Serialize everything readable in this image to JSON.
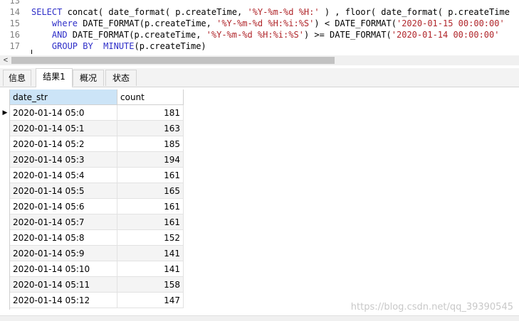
{
  "editor": {
    "lines": [
      {
        "num": "13",
        "parts": []
      },
      {
        "num": "14",
        "parts": [
          {
            "t": "SELECT",
            "c": "kw"
          },
          {
            "t": " concat( date_format( p.createTime, ",
            "c": "plain"
          },
          {
            "t": "'%Y-%m-%d %H:'",
            "c": "str"
          },
          {
            "t": " ) , floor( date_format( p.createTime",
            "c": "plain"
          }
        ]
      },
      {
        "num": "15",
        "parts": [
          {
            "t": "    where",
            "c": "kw"
          },
          {
            "t": " DATE_FORMAT(p.createTime, ",
            "c": "plain"
          },
          {
            "t": "'%Y-%m-%d %H:%i:%S'",
            "c": "str"
          },
          {
            "t": ") < DATE_FORMAT(",
            "c": "plain"
          },
          {
            "t": "'2020-01-15 00:00:00'",
            "c": "str"
          }
        ]
      },
      {
        "num": "16",
        "parts": [
          {
            "t": "    AND",
            "c": "kw"
          },
          {
            "t": " DATE_FORMAT(p.createTime, ",
            "c": "plain"
          },
          {
            "t": "'%Y-%m-%d %H:%i:%S'",
            "c": "str"
          },
          {
            "t": ") >= DATE_FORMAT(",
            "c": "plain"
          },
          {
            "t": "'2020-01-14 00:00:00'",
            "c": "str"
          }
        ]
      },
      {
        "num": "17",
        "parts": [
          {
            "t": "    GROUP BY",
            "c": "kw"
          },
          {
            "t": "  ",
            "c": "plain"
          },
          {
            "t": "MINUTE",
            "c": "fn"
          },
          {
            "t": "(p.createTime)",
            "c": "plain"
          }
        ]
      }
    ]
  },
  "scrollbar": {
    "left_arrow": "<"
  },
  "tabs": [
    {
      "label": "信息",
      "active": false
    },
    {
      "label": "结果1",
      "active": true
    },
    {
      "label": "概况",
      "active": false
    },
    {
      "label": "状态",
      "active": false
    }
  ],
  "grid": {
    "columns": [
      "date_str",
      "count"
    ],
    "row_indicator": "▶",
    "rows": [
      [
        "2020-01-14 05:0",
        "181"
      ],
      [
        "2020-01-14 05:1",
        "163"
      ],
      [
        "2020-01-14 05:2",
        "185"
      ],
      [
        "2020-01-14 05:3",
        "194"
      ],
      [
        "2020-01-14 05:4",
        "161"
      ],
      [
        "2020-01-14 05:5",
        "165"
      ],
      [
        "2020-01-14 05:6",
        "161"
      ],
      [
        "2020-01-14 05:7",
        "161"
      ],
      [
        "2020-01-14 05:8",
        "152"
      ],
      [
        "2020-01-14 05:9",
        "141"
      ],
      [
        "2020-01-14 05:10",
        "141"
      ],
      [
        "2020-01-14 05:11",
        "158"
      ],
      [
        "2020-01-14 05:12",
        "147"
      ]
    ]
  },
  "watermark": "https://blog.csdn.net/qq_39390545"
}
